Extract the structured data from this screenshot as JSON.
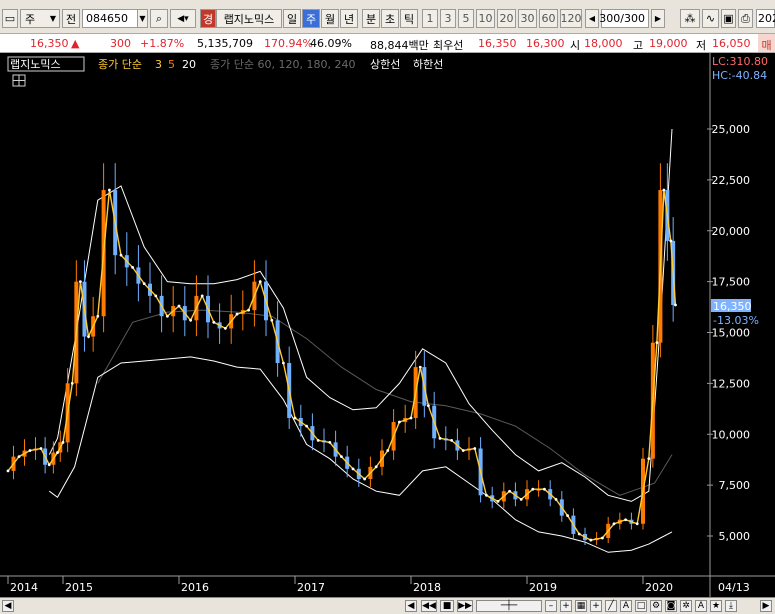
{
  "toolbar": {
    "market_type": "주",
    "prev_label": "전",
    "code": "084650",
    "stock_badge": "경",
    "stock_name": "랩지노믹스",
    "periods": [
      "일",
      "주",
      "월",
      "년"
    ],
    "active_period": "주",
    "minute_labels": [
      "분",
      "초",
      "틱"
    ],
    "intervals": [
      "1",
      "3",
      "5",
      "10",
      "20",
      "30",
      "60",
      "120"
    ],
    "count": "300",
    "count_total": "/300",
    "year_cut": "202"
  },
  "quote": {
    "price": "16,350",
    "direction_icon": "▲",
    "change": "300",
    "change_pct": "+1.87%",
    "volume": "5,135,709",
    "vol_ratio": "170.94%",
    "turnover": "46.09%",
    "amount": "88,844백만",
    "best_label": "최우선",
    "best_ask": "16,350",
    "best_bid": "16,300",
    "open_label": "시",
    "open": "18,000",
    "high_label": "고",
    "high": "19,000",
    "low_label": "저",
    "low": "16,050",
    "sell_cut": "매"
  },
  "legend": {
    "name": "랩지노믹스",
    "ma_label": "종가 단순",
    "ma_periods": [
      "3",
      "5",
      "20"
    ],
    "long_ma_label": "종가 단순 60, 120, 180, 240",
    "upper_limit": "상한선",
    "lower_limit": "하한선"
  },
  "axis_extra": {
    "lc": "LC:310.80",
    "hc": "HC:-40.84",
    "current": "16,350",
    "current_pct": "-13.03%",
    "date_tag": "04/13"
  },
  "colors": {
    "background": "#000000",
    "up": "#ff7a00",
    "down": "#70b0ff",
    "ma3": "#ffcc33",
    "ma5": "#ffffff",
    "band": "#ffffff"
  },
  "chart_data": {
    "type": "line",
    "title": "랩지노믹스",
    "xlabel": "",
    "ylabel": "",
    "x_ticks": [
      "2014",
      "2015",
      "2016",
      "2017",
      "2018",
      "2019",
      "2020"
    ],
    "y_ticks": [
      5000,
      7500,
      10000,
      12500,
      15000,
      17500,
      20000,
      22500,
      25000
    ],
    "ylim": [
      3000,
      28000
    ],
    "grid": false,
    "legend_position": "top-left",
    "series": [
      {
        "name": "종가",
        "x": [
          2014.0,
          2014.2,
          2014.4,
          2014.6,
          2014.75,
          2014.9,
          2015.0,
          2015.08,
          2015.15,
          2015.22,
          2015.3,
          2015.4,
          2015.5,
          2015.6,
          2015.7,
          2015.8,
          2015.9,
          2016.0,
          2016.1,
          2016.2,
          2016.3,
          2016.4,
          2016.5,
          2016.6,
          2016.7,
          2016.8,
          2016.9,
          2017.0,
          2017.1,
          2017.2,
          2017.3,
          2017.4,
          2017.5,
          2017.6,
          2017.7,
          2017.8,
          2017.9,
          2018.0,
          2018.08,
          2018.15,
          2018.25,
          2018.35,
          2018.45,
          2018.55,
          2018.65,
          2018.75,
          2018.85,
          2018.95,
          2019.05,
          2019.15,
          2019.25,
          2019.35,
          2019.45,
          2019.55,
          2019.65,
          2019.75,
          2019.85,
          2019.95,
          2020.05,
          2020.12,
          2020.18,
          2020.24,
          2020.28
        ],
        "values": [
          8200,
          8900,
          9200,
          9300,
          8500,
          9100,
          9600,
          12500,
          17500,
          14800,
          15800,
          22000,
          18800,
          18200,
          17400,
          16800,
          15800,
          16300,
          15600,
          16800,
          15500,
          15200,
          15900,
          16100,
          17500,
          15600,
          13500,
          10800,
          10400,
          9700,
          9600,
          8900,
          8300,
          7800,
          8400,
          9200,
          10600,
          10800,
          13300,
          11400,
          9800,
          9700,
          9200,
          9300,
          7000,
          6700,
          7200,
          6800,
          7300,
          7300,
          6800,
          6000,
          5100,
          4800,
          4900,
          5600,
          5800,
          5600,
          8800,
          14500,
          22000,
          19500,
          16350
        ]
      },
      {
        "name": "상한선",
        "x": [
          2014.75,
          2014.9,
          2015.1,
          2015.3,
          2015.5,
          2015.7,
          2015.9,
          2016.1,
          2016.3,
          2016.5,
          2016.7,
          2016.9,
          2017.1,
          2017.3,
          2017.5,
          2017.7,
          2017.9,
          2018.1,
          2018.3,
          2018.5,
          2018.7,
          2018.9,
          2019.1,
          2019.3,
          2019.5,
          2019.7,
          2019.9,
          2020.05,
          2020.15,
          2020.25
        ],
        "values": [
          9000,
          9800,
          14500,
          21500,
          22200,
          19200,
          17500,
          17400,
          17400,
          17600,
          18000,
          16200,
          12800,
          11800,
          11200,
          11300,
          12500,
          14200,
          13500,
          11500,
          10200,
          9000,
          8200,
          8600,
          7900,
          7000,
          6700,
          7200,
          15500,
          25000
        ]
      },
      {
        "name": "하한선",
        "x": [
          2014.75,
          2014.9,
          2015.1,
          2015.3,
          2015.5,
          2015.7,
          2015.9,
          2016.1,
          2016.3,
          2016.5,
          2016.7,
          2016.9,
          2017.1,
          2017.3,
          2017.5,
          2017.7,
          2017.9,
          2018.1,
          2018.3,
          2018.5,
          2018.7,
          2018.9,
          2019.1,
          2019.3,
          2019.5,
          2019.7,
          2019.9,
          2020.05,
          2020.15,
          2020.25
        ],
        "values": [
          7200,
          6900,
          8400,
          12800,
          13500,
          13600,
          13700,
          13800,
          13600,
          13300,
          13200,
          11700,
          9500,
          8800,
          7800,
          7200,
          7000,
          8200,
          8400,
          7600,
          6800,
          5800,
          5200,
          5000,
          4700,
          4200,
          4300,
          4600,
          4900,
          5200
        ]
      },
      {
        "name": "종가 단순 60",
        "x": [
          2015.3,
          2015.6,
          2015.9,
          2016.2,
          2016.5,
          2016.8,
          2017.1,
          2017.4,
          2017.7,
          2018.0,
          2018.3,
          2018.6,
          2018.9,
          2019.2,
          2019.5,
          2019.8,
          2020.1,
          2020.25
        ],
        "values": [
          12500,
          15500,
          16000,
          16100,
          16000,
          15800,
          14700,
          13300,
          12200,
          11600,
          11400,
          11000,
          10400,
          9300,
          8000,
          7000,
          7600,
          9000
        ]
      }
    ]
  }
}
